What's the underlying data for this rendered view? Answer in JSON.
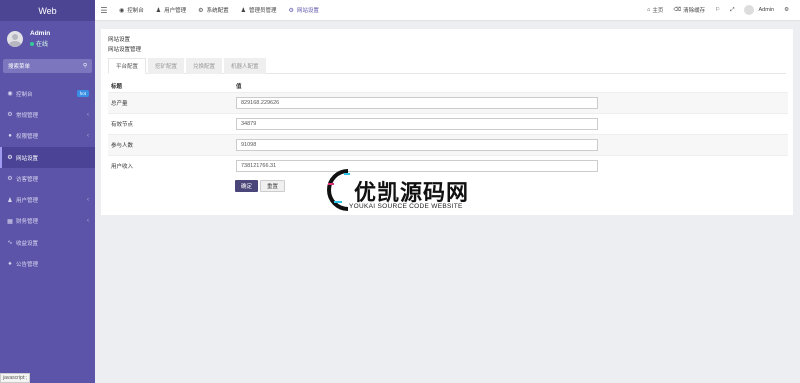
{
  "sidebar": {
    "logo": "Web",
    "user": {
      "name": "Admin",
      "status": "在线"
    },
    "search_placeholder": "搜索菜单",
    "items": [
      {
        "label": "控制台",
        "badge": "hot",
        "icon": "dashboard-icon"
      },
      {
        "label": "常规管理",
        "icon": "cogs-icon"
      },
      {
        "label": "权限管理",
        "icon": "group-icon"
      },
      {
        "label": "网站设置",
        "icon": "cogs-icon"
      },
      {
        "label": "访客管理",
        "icon": "cogs-icon"
      },
      {
        "label": "用户管理",
        "icon": "user-icon"
      },
      {
        "label": "财务管理",
        "icon": "money-icon"
      },
      {
        "label": "收益设置",
        "icon": "chart-icon"
      },
      {
        "label": "公告管理",
        "icon": "bell-icon"
      }
    ],
    "statusbar": "javascript:;"
  },
  "topbar": {
    "tabs": [
      {
        "label": "控制台",
        "icon": "dashboard-icon"
      },
      {
        "label": "用户管理",
        "icon": "user-icon"
      },
      {
        "label": "系统配置",
        "icon": "gear-icon"
      },
      {
        "label": "管理员管理",
        "icon": "user-icon"
      },
      {
        "label": "网站设置",
        "icon": "cogs-icon"
      }
    ],
    "right": {
      "home": "主页",
      "clear_cache": "清除缓存",
      "username": "Admin"
    }
  },
  "panel": {
    "title": "网站设置",
    "subtitle": "网站设置管理",
    "tabs": [
      "平台配置",
      "挖矿配置",
      "兑换配置",
      "机器人配置"
    ],
    "table": {
      "headers": [
        "标题",
        "值"
      ],
      "rows": [
        {
          "label": "总产量",
          "value": "829168.229626"
        },
        {
          "label": "有效节点",
          "value": "34879"
        },
        {
          "label": "参与人数",
          "value": "91098"
        },
        {
          "label": "用户收入",
          "value": "738121766.31"
        }
      ]
    },
    "buttons": {
      "confirm": "确定",
      "reset": "重置"
    }
  },
  "watermark": {
    "cn": "优凯源码网",
    "en": "YOUKAI SOURCE CODE WEBSITE"
  },
  "colors": {
    "sidebar": "#5b54a8",
    "logo_bg": "#4c4594",
    "active_menu": "#4a4396",
    "primary_button": "#4b4679"
  }
}
